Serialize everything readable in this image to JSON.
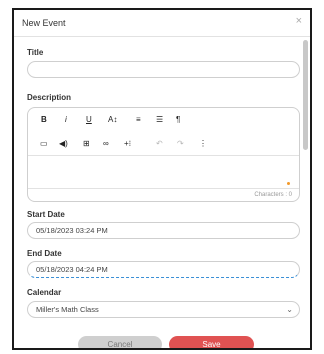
{
  "dialog": {
    "title": "New Event",
    "close_glyph": "×"
  },
  "form": {
    "title_label": "Title",
    "title_value": "",
    "description_label": "Description",
    "start_label": "Start Date",
    "start_value": "05/18/2023 03:24 PM",
    "end_label": "End Date",
    "end_value": "05/18/2023 04:24 PM",
    "calendar_label": "Calendar",
    "calendar_value": "Miller's Math Class"
  },
  "editor": {
    "toolbar_row1": [
      {
        "name": "bold-icon",
        "glyph": "B"
      },
      {
        "name": "italic-icon",
        "glyph": "i"
      },
      {
        "name": "underline-icon",
        "glyph": "U"
      },
      {
        "name": "font-size-icon",
        "glyph": "A↕"
      },
      {
        "name": "align-icon",
        "glyph": "≡"
      },
      {
        "name": "list-icon",
        "glyph": "☰"
      },
      {
        "name": "paragraph-icon",
        "glyph": "¶"
      }
    ],
    "toolbar_row2": [
      {
        "name": "video-icon",
        "glyph": "▭"
      },
      {
        "name": "audio-icon",
        "glyph": "◀)"
      },
      {
        "name": "table-icon",
        "glyph": "⊞"
      },
      {
        "name": "link-icon",
        "glyph": "∞"
      },
      {
        "name": "insert-icon",
        "glyph": "+⁝"
      },
      {
        "name": "undo-icon",
        "glyph": "↶"
      },
      {
        "name": "redo-icon",
        "glyph": "↷"
      },
      {
        "name": "more-icon",
        "glyph": "⋮"
      }
    ],
    "characters_text": "Characters : 0"
  },
  "buttons": {
    "cancel": "Cancel",
    "save": "Save"
  },
  "colors": {
    "accent_red": "#e05252",
    "focus_blue": "#3a8fd6",
    "indicator_orange": "#f39a2b"
  }
}
